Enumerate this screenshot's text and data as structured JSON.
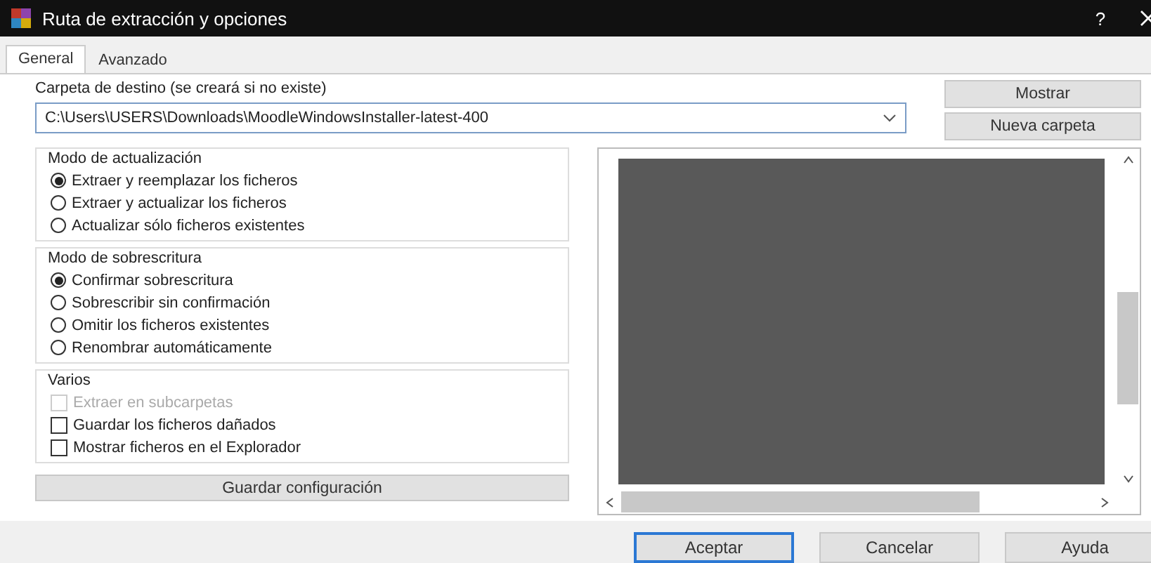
{
  "window": {
    "title": "Ruta de extracción y opciones",
    "help": "?"
  },
  "tabs": [
    {
      "label": "General",
      "selected": true
    },
    {
      "label": "Avanzado",
      "selected": false
    }
  ],
  "destination": {
    "label": "Carpeta de destino (se creará si no existe)",
    "value": "C:\\Users\\USERS\\Downloads\\MoodleWindowsInstaller-latest-400"
  },
  "side_buttons": [
    "Mostrar",
    "Nueva carpeta"
  ],
  "groups": [
    {
      "title": "Modo de actualización",
      "options": [
        {
          "kind": "radio",
          "label": "Extraer y reemplazar los ficheros",
          "selected": true
        },
        {
          "kind": "radio",
          "label": "Extraer y actualizar los ficheros",
          "selected": false
        },
        {
          "kind": "radio",
          "label": "Actualizar sólo ficheros existentes",
          "selected": false
        }
      ]
    },
    {
      "title": "Modo de sobrescritura",
      "options": [
        {
          "kind": "radio",
          "label": "Confirmar sobrescritura",
          "selected": true
        },
        {
          "kind": "radio",
          "label": "Sobrescribir sin confirmación",
          "selected": false
        },
        {
          "kind": "radio",
          "label": "Omitir los ficheros existentes",
          "selected": false
        },
        {
          "kind": "radio",
          "label": "Renombrar automáticamente",
          "selected": false
        }
      ]
    },
    {
      "title": "Varios",
      "options": [
        {
          "kind": "checkbox",
          "label": "Extraer en subcarpetas",
          "checked": false,
          "disabled": true
        },
        {
          "kind": "checkbox",
          "label": "Guardar los ficheros dañados",
          "checked": false,
          "disabled": false
        },
        {
          "kind": "checkbox",
          "label": "Mostrar ficheros en el Explorador",
          "checked": false,
          "disabled": false
        }
      ]
    }
  ],
  "save_button": "Guardar configuración",
  "footer_buttons": [
    {
      "label": "Aceptar",
      "default": true
    },
    {
      "label": "Cancelar",
      "default": false
    },
    {
      "label": "Ayuda",
      "default": false
    }
  ]
}
